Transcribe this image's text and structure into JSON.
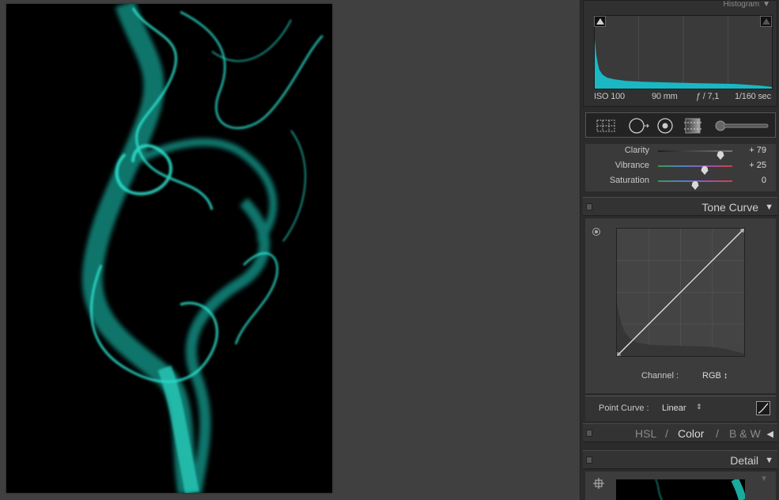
{
  "histogram": {
    "title": "Histogram",
    "iso": "ISO 100",
    "focal_length": "90 mm",
    "aperture": "ƒ / 7,1",
    "shutter": "1/160 sec"
  },
  "tools": [
    "crop-overlay",
    "spot-removal",
    "red-eye",
    "graduated-filter",
    "adjustment-brush"
  ],
  "basic": {
    "sliders": [
      {
        "label": "Clarity",
        "value": "+ 79",
        "position": 0.845
      },
      {
        "label": "Vibrance",
        "value": "+ 25",
        "position": 0.625
      },
      {
        "label": "Saturation",
        "value": "0",
        "position": 0.5
      }
    ]
  },
  "tone_curve": {
    "title": "Tone Curve",
    "channel_label": "Channel :",
    "channel_value": "RGB ↕",
    "point_curve_label": "Point Curve :",
    "point_curve_value": "Linear"
  },
  "hsl": {
    "tab_hsl": "HSL",
    "sep1": "/",
    "tab_color": "Color",
    "sep2": "/",
    "tab_bw": "B & W"
  },
  "detail": {
    "title": "Detail"
  },
  "colors": {
    "smoke": "#1fd6c4",
    "histogram_fill": "#19b8c4",
    "panel": "#3c3c3c"
  }
}
